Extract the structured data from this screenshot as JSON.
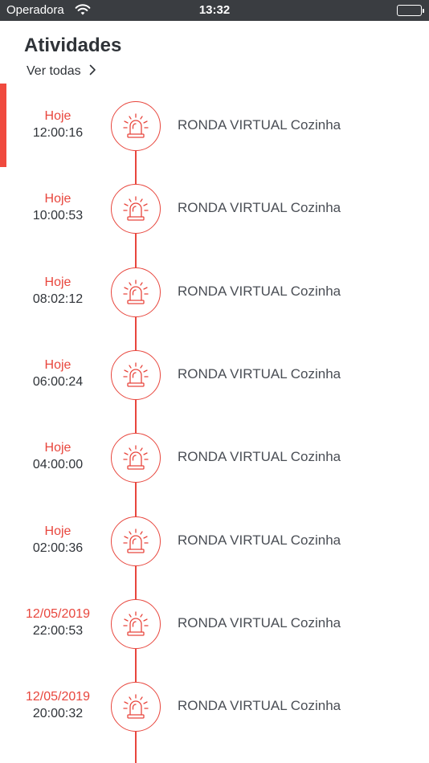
{
  "status_bar": {
    "carrier": "Operadora",
    "time": "13:32"
  },
  "header": {
    "title": "Atividades",
    "see_all": "Ver todas"
  },
  "colors": {
    "accent": "#e8463d",
    "status_bar_bg": "#3a3d41",
    "text": "#2f3338"
  },
  "activities": [
    {
      "day": "Hoje",
      "time": "12:00:16",
      "label": "RONDA VIRTUAL Cozinha",
      "icon": "alarm-siren-icon"
    },
    {
      "day": "Hoje",
      "time": "10:00:53",
      "label": "RONDA VIRTUAL Cozinha",
      "icon": "alarm-siren-icon"
    },
    {
      "day": "Hoje",
      "time": "08:02:12",
      "label": "RONDA VIRTUAL Cozinha",
      "icon": "alarm-siren-icon"
    },
    {
      "day": "Hoje",
      "time": "06:00:24",
      "label": "RONDA VIRTUAL Cozinha",
      "icon": "alarm-siren-icon"
    },
    {
      "day": "Hoje",
      "time": "04:00:00",
      "label": "RONDA VIRTUAL Cozinha",
      "icon": "alarm-siren-icon"
    },
    {
      "day": "Hoje",
      "time": "02:00:36",
      "label": "RONDA VIRTUAL Cozinha",
      "icon": "alarm-siren-icon"
    },
    {
      "day": "12/05/2019",
      "time": "22:00:53",
      "label": "RONDA VIRTUAL Cozinha",
      "icon": "alarm-siren-icon"
    },
    {
      "day": "12/05/2019",
      "time": "20:00:32",
      "label": "RONDA VIRTUAL Cozinha",
      "icon": "alarm-siren-icon"
    }
  ]
}
